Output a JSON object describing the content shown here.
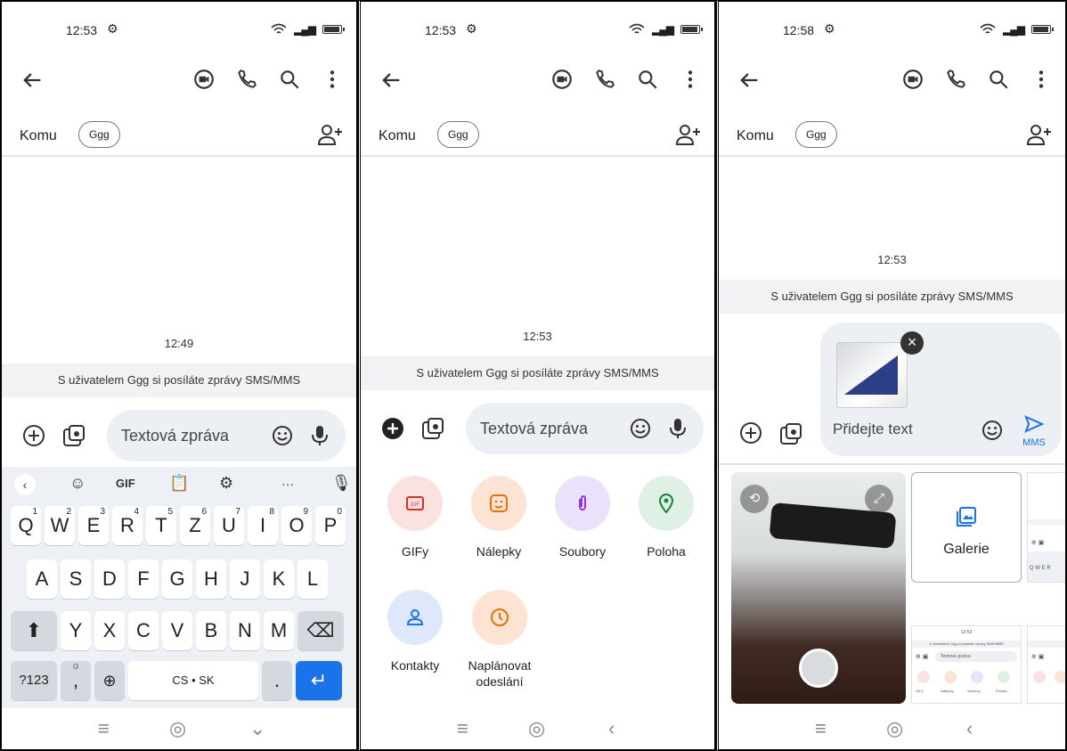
{
  "screens": [
    {
      "status": {
        "time": "12:53"
      },
      "to": {
        "label": "Komu",
        "chip": "Ggg"
      },
      "timestamp": "12:49",
      "info": "S uživatelem Ggg si posíláte zprávy SMS/MMS",
      "composer": {
        "placeholder": "Textová zpráva"
      },
      "keyboard": {
        "toolbar": {
          "gif": "GIF",
          "more": "···"
        },
        "row1": [
          "Q",
          "W",
          "E",
          "R",
          "T",
          "Z",
          "U",
          "I",
          "O",
          "P"
        ],
        "row1_hints": [
          "1",
          "2",
          "3",
          "4",
          "5",
          "6",
          "7",
          "8",
          "9",
          "0"
        ],
        "row2": [
          "A",
          "S",
          "D",
          "F",
          "G",
          "H",
          "J",
          "K",
          "L"
        ],
        "row3": [
          "Y",
          "X",
          "C",
          "V",
          "B",
          "N",
          "M"
        ],
        "numbers_key": "?123",
        "comma_key": ",",
        "space_label": "CS • SK",
        "period_key": "."
      }
    },
    {
      "status": {
        "time": "12:53"
      },
      "to": {
        "label": "Komu",
        "chip": "Ggg"
      },
      "timestamp": "12:53",
      "info": "S uživatelem Ggg si posíláte zprávy SMS/MMS",
      "composer": {
        "placeholder": "Textová zpráva"
      },
      "attachments": [
        {
          "label": "GIFy",
          "icon": "gif-icon",
          "bg": "#fbe1e0"
        },
        {
          "label": "Nálepky",
          "icon": "sticker-icon",
          "bg": "#fde3d3"
        },
        {
          "label": "Soubory",
          "icon": "paperclip-icon",
          "bg": "#ece1fb"
        },
        {
          "label": "Poloha",
          "icon": "location-pin-icon",
          "bg": "#dff1e4"
        },
        {
          "label": "Kontakty",
          "icon": "contact-icon",
          "bg": "#dfe8fb"
        },
        {
          "label": "Naplánovat odeslání",
          "icon": "clock-icon",
          "bg": "#fde3d3"
        }
      ]
    },
    {
      "status": {
        "time": "12:58"
      },
      "to": {
        "label": "Komu",
        "chip": "Ggg"
      },
      "timestamp": "12:53",
      "info": "S uživatelem Ggg si posíláte zprávy SMS/MMS",
      "composer": {
        "placeholder": "Přidejte text",
        "send_label": "MMS"
      },
      "gallery_label": "Galerie",
      "mini_preview": {
        "time": "12:53",
        "info": "S uživatelem Ggg si posíláte zprávy SMS/MMS",
        "placeholder": "Textová zpráva",
        "labels": [
          "GIFy",
          "Nálepky",
          "Soubory",
          "Poloha"
        ]
      }
    }
  ],
  "colors": {
    "accent": "#1a73e8",
    "keyboard_bg": "#edf0f5",
    "field_bg": "#eceff4"
  }
}
